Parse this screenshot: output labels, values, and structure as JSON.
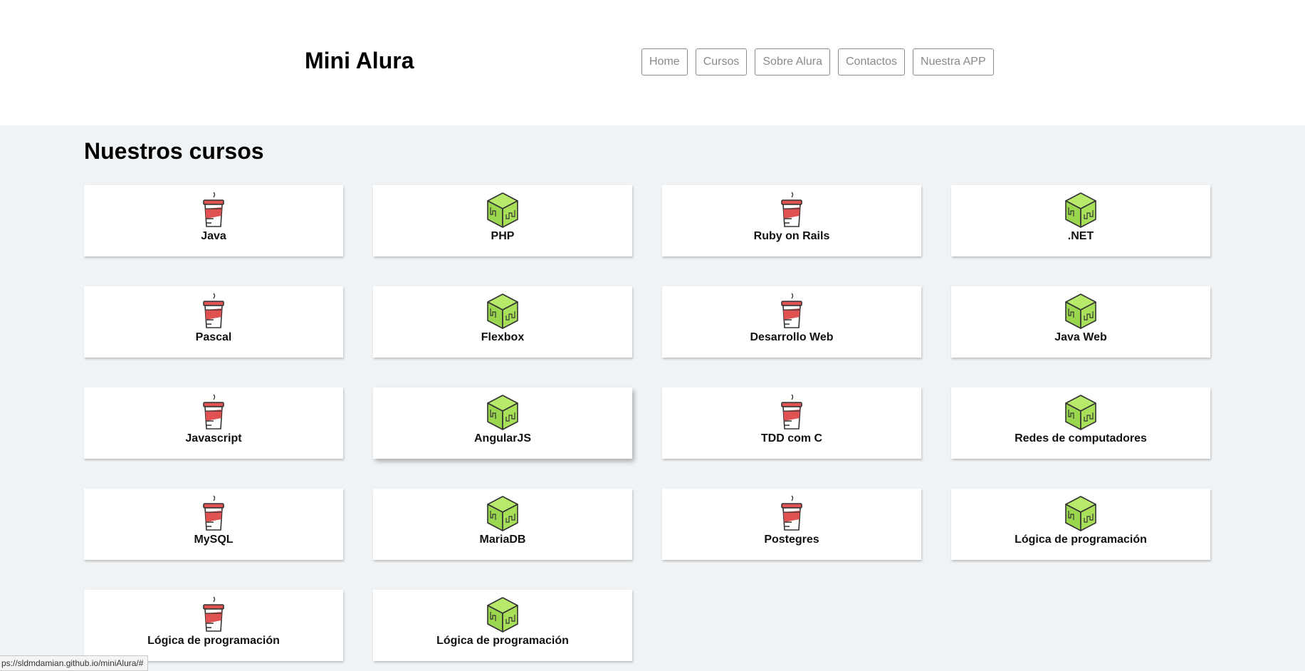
{
  "header": {
    "logo": "Mini Alura",
    "nav": [
      "Home",
      "Cursos",
      "Sobre Alura",
      "Contactos",
      "Nuestra APP"
    ]
  },
  "main": {
    "title": "Nuestros cursos",
    "courses": [
      {
        "title": "Java",
        "icon": "coffee-cup-icon"
      },
      {
        "title": "PHP",
        "icon": "green-cube-icon"
      },
      {
        "title": "Ruby on Rails",
        "icon": "coffee-cup-icon"
      },
      {
        "title": ".NET",
        "icon": "green-cube-icon"
      },
      {
        "title": "Pascal",
        "icon": "coffee-cup-icon"
      },
      {
        "title": "Flexbox",
        "icon": "green-cube-icon"
      },
      {
        "title": "Desarrollo Web",
        "icon": "coffee-cup-icon"
      },
      {
        "title": "Java Web",
        "icon": "green-cube-icon"
      },
      {
        "title": "Javascript",
        "icon": "coffee-cup-icon"
      },
      {
        "title": "AngularJS",
        "icon": "green-cube-icon"
      },
      {
        "title": "TDD com C",
        "icon": "coffee-cup-icon"
      },
      {
        "title": "Redes de computadores",
        "icon": "green-cube-icon"
      },
      {
        "title": "MySQL",
        "icon": "coffee-cup-icon"
      },
      {
        "title": "MariaDB",
        "icon": "green-cube-icon"
      },
      {
        "title": "Postegres",
        "icon": "coffee-cup-icon"
      },
      {
        "title": "Lógica de programación",
        "icon": "green-cube-icon"
      },
      {
        "title": "Lógica de programación",
        "icon": "coffee-cup-icon"
      },
      {
        "title": "Lógica de programación",
        "icon": "green-cube-icon"
      }
    ]
  },
  "statusbar": {
    "url": "ps://sldmdamian.github.io/miniAlura/#"
  },
  "colors": {
    "background": "#f0f3f5",
    "cup_red": "#e05252",
    "cube_green": "#a8e05a"
  }
}
